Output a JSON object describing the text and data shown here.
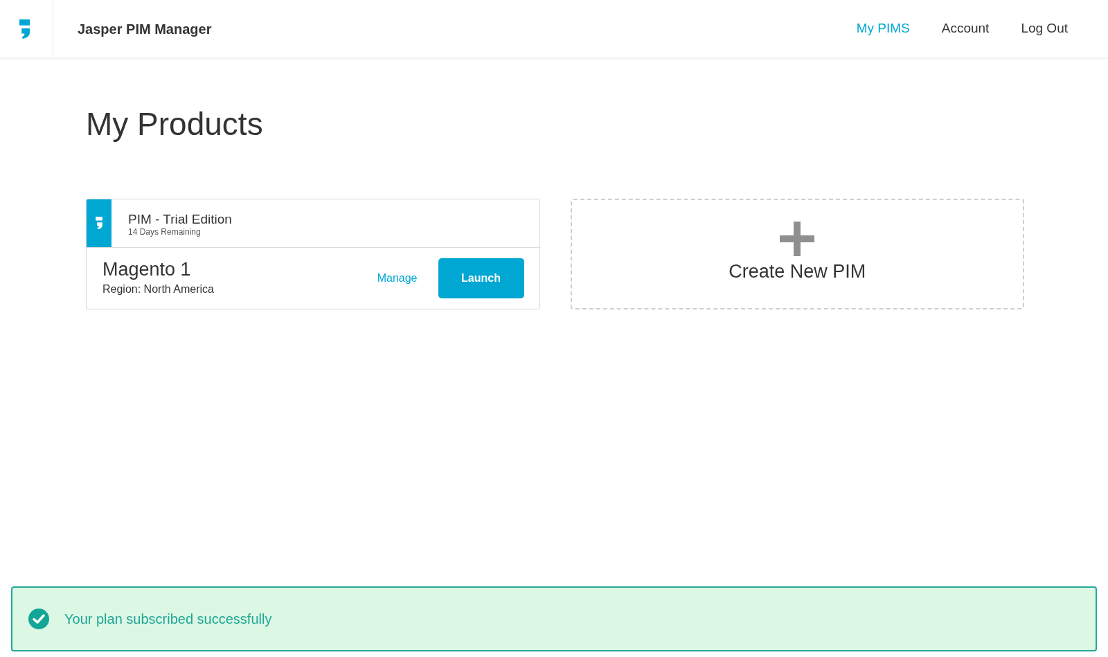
{
  "header": {
    "title": "Jasper PIM Manager",
    "nav": [
      {
        "label": "My PIMS",
        "selected": true
      },
      {
        "label": "Account",
        "selected": false
      },
      {
        "label": "Log Out",
        "selected": false
      }
    ]
  },
  "page": {
    "heading": "My Products"
  },
  "products": [
    {
      "edition": "PIM - Trial Edition",
      "remaining": "14 Days Remaining",
      "name": "Magento 1",
      "region": "Region: North America",
      "manage": "Manage",
      "launch": "Launch"
    }
  ],
  "create": {
    "label": "Create New PIM"
  },
  "toast": {
    "message": "Your plan subscribed successfully"
  }
}
